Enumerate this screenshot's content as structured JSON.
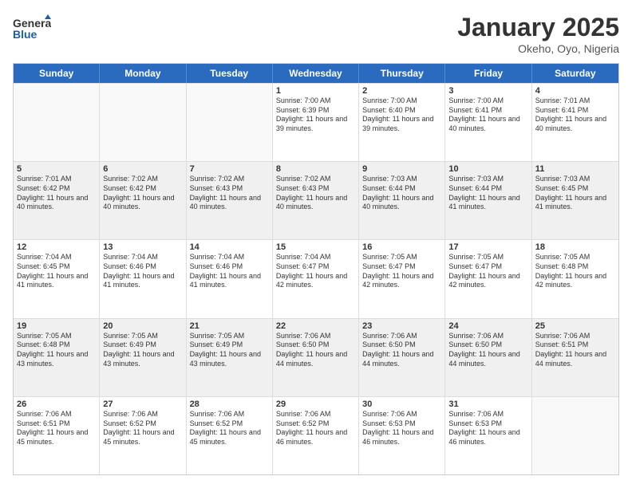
{
  "logo": {
    "line1": "General",
    "line2": "Blue"
  },
  "title": "January 2025",
  "subtitle": "Okeho, Oyo, Nigeria",
  "days": [
    "Sunday",
    "Monday",
    "Tuesday",
    "Wednesday",
    "Thursday",
    "Friday",
    "Saturday"
  ],
  "rows": [
    [
      {
        "day": "",
        "empty": true
      },
      {
        "day": "",
        "empty": true
      },
      {
        "day": "",
        "empty": true
      },
      {
        "day": "1",
        "sunrise": "7:00 AM",
        "sunset": "6:39 PM",
        "daylight": "11 hours and 39 minutes."
      },
      {
        "day": "2",
        "sunrise": "7:00 AM",
        "sunset": "6:40 PM",
        "daylight": "11 hours and 39 minutes."
      },
      {
        "day": "3",
        "sunrise": "7:00 AM",
        "sunset": "6:41 PM",
        "daylight": "11 hours and 40 minutes."
      },
      {
        "day": "4",
        "sunrise": "7:01 AM",
        "sunset": "6:41 PM",
        "daylight": "11 hours and 40 minutes."
      }
    ],
    [
      {
        "day": "5",
        "sunrise": "7:01 AM",
        "sunset": "6:42 PM",
        "daylight": "11 hours and 40 minutes."
      },
      {
        "day": "6",
        "sunrise": "7:02 AM",
        "sunset": "6:42 PM",
        "daylight": "11 hours and 40 minutes."
      },
      {
        "day": "7",
        "sunrise": "7:02 AM",
        "sunset": "6:43 PM",
        "daylight": "11 hours and 40 minutes."
      },
      {
        "day": "8",
        "sunrise": "7:02 AM",
        "sunset": "6:43 PM",
        "daylight": "11 hours and 40 minutes."
      },
      {
        "day": "9",
        "sunrise": "7:03 AM",
        "sunset": "6:44 PM",
        "daylight": "11 hours and 40 minutes."
      },
      {
        "day": "10",
        "sunrise": "7:03 AM",
        "sunset": "6:44 PM",
        "daylight": "11 hours and 41 minutes."
      },
      {
        "day": "11",
        "sunrise": "7:03 AM",
        "sunset": "6:45 PM",
        "daylight": "11 hours and 41 minutes."
      }
    ],
    [
      {
        "day": "12",
        "sunrise": "7:04 AM",
        "sunset": "6:45 PM",
        "daylight": "11 hours and 41 minutes."
      },
      {
        "day": "13",
        "sunrise": "7:04 AM",
        "sunset": "6:46 PM",
        "daylight": "11 hours and 41 minutes."
      },
      {
        "day": "14",
        "sunrise": "7:04 AM",
        "sunset": "6:46 PM",
        "daylight": "11 hours and 41 minutes."
      },
      {
        "day": "15",
        "sunrise": "7:04 AM",
        "sunset": "6:47 PM",
        "daylight": "11 hours and 42 minutes."
      },
      {
        "day": "16",
        "sunrise": "7:05 AM",
        "sunset": "6:47 PM",
        "daylight": "11 hours and 42 minutes."
      },
      {
        "day": "17",
        "sunrise": "7:05 AM",
        "sunset": "6:47 PM",
        "daylight": "11 hours and 42 minutes."
      },
      {
        "day": "18",
        "sunrise": "7:05 AM",
        "sunset": "6:48 PM",
        "daylight": "11 hours and 42 minutes."
      }
    ],
    [
      {
        "day": "19",
        "sunrise": "7:05 AM",
        "sunset": "6:48 PM",
        "daylight": "11 hours and 43 minutes."
      },
      {
        "day": "20",
        "sunrise": "7:05 AM",
        "sunset": "6:49 PM",
        "daylight": "11 hours and 43 minutes."
      },
      {
        "day": "21",
        "sunrise": "7:05 AM",
        "sunset": "6:49 PM",
        "daylight": "11 hours and 43 minutes."
      },
      {
        "day": "22",
        "sunrise": "7:06 AM",
        "sunset": "6:50 PM",
        "daylight": "11 hours and 44 minutes."
      },
      {
        "day": "23",
        "sunrise": "7:06 AM",
        "sunset": "6:50 PM",
        "daylight": "11 hours and 44 minutes."
      },
      {
        "day": "24",
        "sunrise": "7:06 AM",
        "sunset": "6:50 PM",
        "daylight": "11 hours and 44 minutes."
      },
      {
        "day": "25",
        "sunrise": "7:06 AM",
        "sunset": "6:51 PM",
        "daylight": "11 hours and 44 minutes."
      }
    ],
    [
      {
        "day": "26",
        "sunrise": "7:06 AM",
        "sunset": "6:51 PM",
        "daylight": "11 hours and 45 minutes."
      },
      {
        "day": "27",
        "sunrise": "7:06 AM",
        "sunset": "6:52 PM",
        "daylight": "11 hours and 45 minutes."
      },
      {
        "day": "28",
        "sunrise": "7:06 AM",
        "sunset": "6:52 PM",
        "daylight": "11 hours and 45 minutes."
      },
      {
        "day": "29",
        "sunrise": "7:06 AM",
        "sunset": "6:52 PM",
        "daylight": "11 hours and 46 minutes."
      },
      {
        "day": "30",
        "sunrise": "7:06 AM",
        "sunset": "6:53 PM",
        "daylight": "11 hours and 46 minutes."
      },
      {
        "day": "31",
        "sunrise": "7:06 AM",
        "sunset": "6:53 PM",
        "daylight": "11 hours and 46 minutes."
      },
      {
        "day": "",
        "empty": true
      }
    ]
  ],
  "labels": {
    "sunrise": "Sunrise:",
    "sunset": "Sunset:",
    "daylight": "Daylight:"
  }
}
